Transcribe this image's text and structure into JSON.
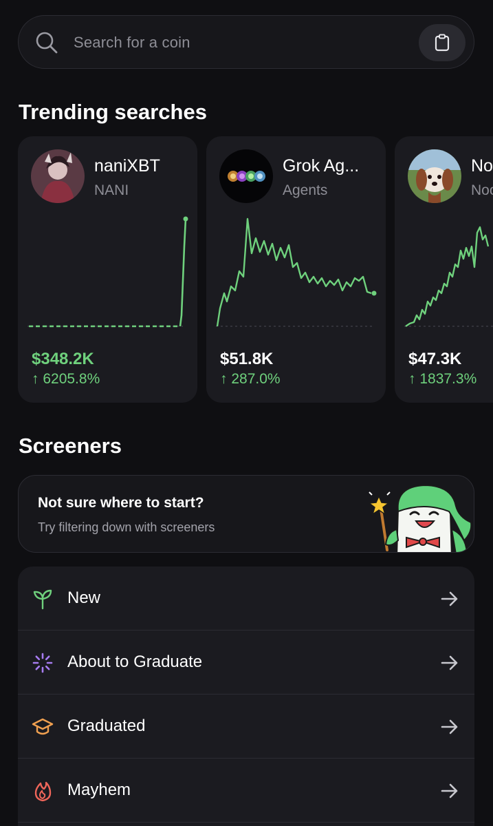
{
  "search": {
    "placeholder": "Search for a coin",
    "icon": "search-icon",
    "paste_icon": "clipboard-icon"
  },
  "trending": {
    "title": "Trending searches",
    "cards": [
      {
        "name": "naniXBT",
        "ticker": "NANI",
        "market_cap": "$348.2K",
        "change": "↑ 6205.8%",
        "color": "#6fd17d",
        "avatar": "anime-girl-avatar"
      },
      {
        "name": "Grok Ag...",
        "ticker": "Agents",
        "market_cap": "$51.8K",
        "change": "↑ 287.0%",
        "color": "#6fd17d",
        "avatar": "orbs-avatar"
      },
      {
        "name": "Noo",
        "ticker": "Noo",
        "market_cap": "$47.3K",
        "change": "↑ 1837.3%",
        "color": "#6fd17d",
        "avatar": "dog-avatar"
      }
    ]
  },
  "screeners": {
    "title": "Screeners",
    "banner": {
      "title": "Not sure where to start?",
      "subtitle": "Try filtering down with screeners",
      "mascot": "mascot-wizard-illustration"
    },
    "items": [
      {
        "label": "New",
        "icon": "sprout-icon",
        "icon_color": "#6fd17d"
      },
      {
        "label": "About to Graduate",
        "icon": "loader-icon",
        "icon_color": "#a77cf0"
      },
      {
        "label": "Graduated",
        "icon": "graduation-cap-icon",
        "icon_color": "#f0a050"
      },
      {
        "label": "Mayhem",
        "icon": "flame-icon",
        "icon_color": "#f0665a"
      }
    ]
  },
  "colors": {
    "background": "#0f0f12",
    "card": "#1b1b20",
    "accent_green": "#6fd17d",
    "muted": "#8e8e96"
  }
}
